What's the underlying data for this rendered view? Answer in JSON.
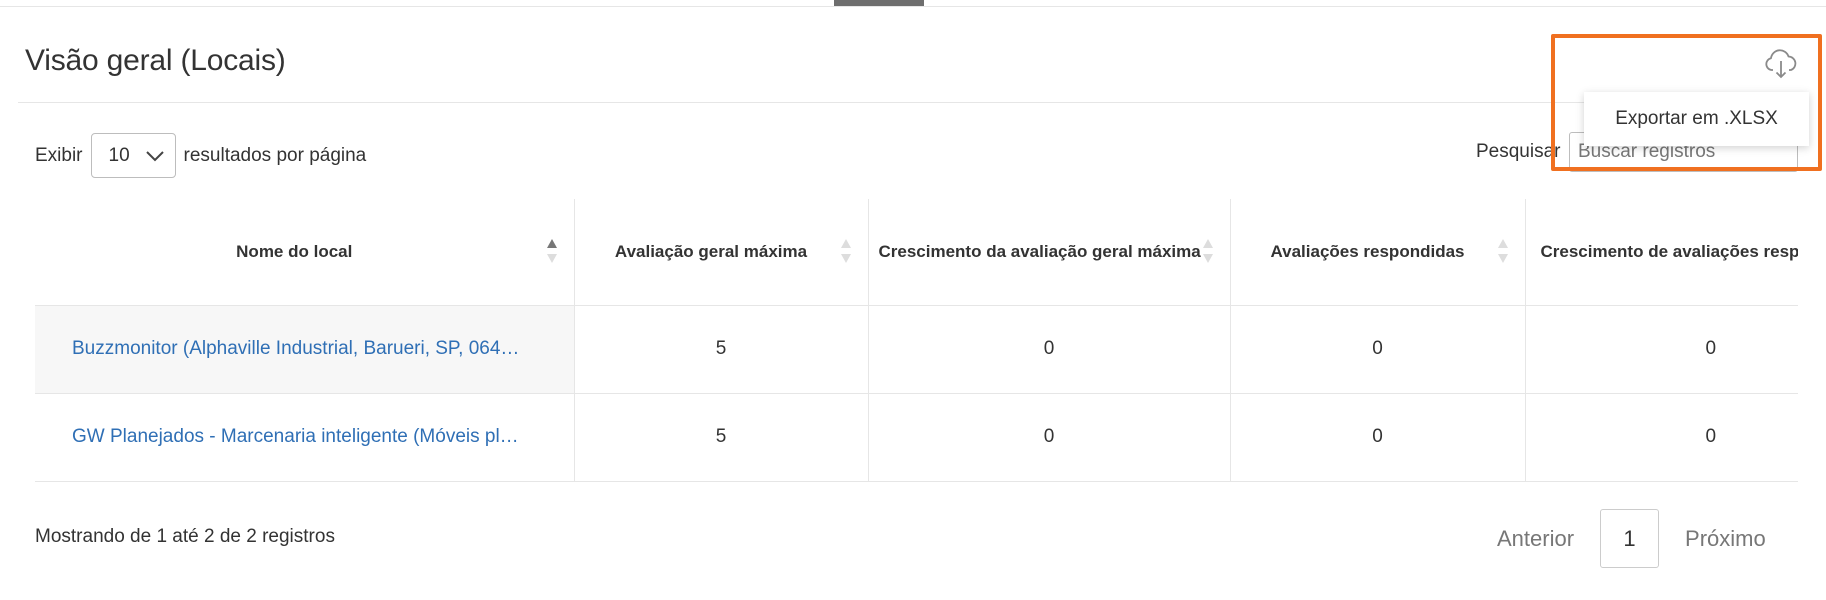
{
  "header": {
    "title": "Visão geral (Locais)"
  },
  "export": {
    "icon": "cloud-download-icon",
    "menu_item": "Exportar em .XLSX",
    "highlight_color": "#f07020"
  },
  "length_control": {
    "prefix": "Exibir",
    "value": "10",
    "suffix": "resultados por página"
  },
  "search": {
    "label": "Pesquisar",
    "placeholder": "Buscar registros"
  },
  "table": {
    "columns": [
      "Nome do local",
      "Avaliação geral máxima",
      "Crescimento da avaliação geral máxima",
      "Avaliações respondidas",
      "Crescimento de avaliações respondidas"
    ],
    "rows": [
      {
        "name": "Buzzmonitor (Alphaville Industrial, Barueri, SP, 064…",
        "max_rating": "5",
        "rating_growth": "0",
        "answered": "0",
        "answered_growth": "0"
      },
      {
        "name": "GW Planejados - Marcenaria inteligente (Móveis pl…",
        "max_rating": "5",
        "rating_growth": "0",
        "answered": "0",
        "answered_growth": "0"
      }
    ]
  },
  "footer": {
    "info": "Mostrando de 1 até 2 de 2 registros",
    "prev": "Anterior",
    "current_page": "1",
    "next": "Próximo"
  },
  "colors": {
    "link": "#2f6fb5",
    "tab_indicator": "#6e6e6e"
  }
}
